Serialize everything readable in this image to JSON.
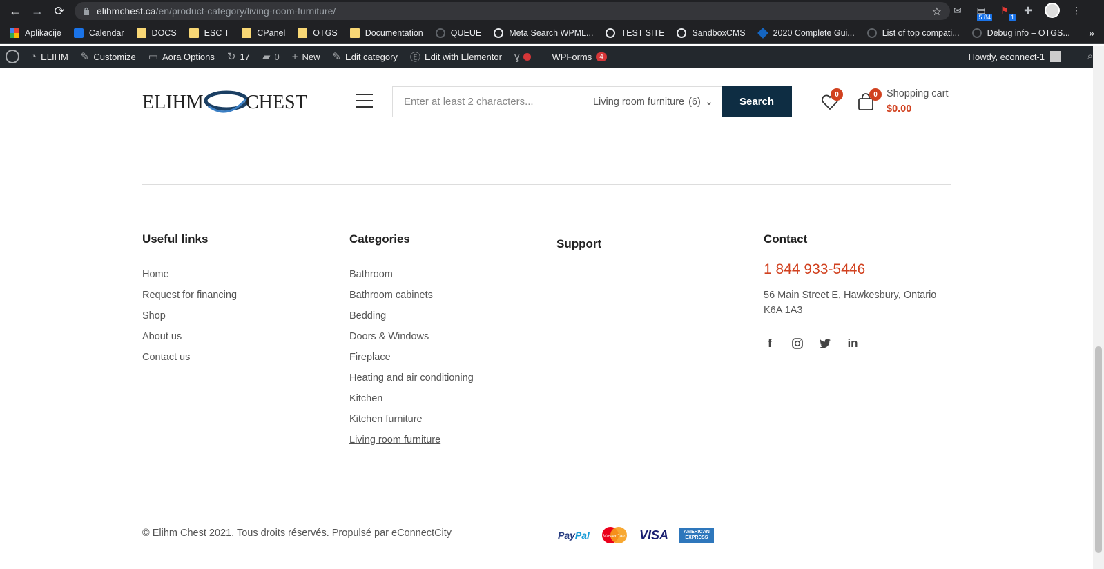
{
  "browser": {
    "url_host": "elihmchest.ca",
    "url_path": "/en/product-category/living-room-furniture/",
    "ext_badge_1": "5.84",
    "ext_badge_2": "1"
  },
  "bookmarks": [
    {
      "label": "Aplikacije",
      "icon": "apps-icon"
    },
    {
      "label": "Calendar",
      "icon": "calendar-icon"
    },
    {
      "label": "DOCS",
      "icon": "folder-icon"
    },
    {
      "label": "ESC T",
      "icon": "folder-icon"
    },
    {
      "label": "CPanel",
      "icon": "folder-icon"
    },
    {
      "label": "OTGS",
      "icon": "folder-icon"
    },
    {
      "label": "Documentation",
      "icon": "folder-icon"
    },
    {
      "label": "QUEUE",
      "icon": "page-icon"
    },
    {
      "label": "Meta Search WPML...",
      "icon": "search-icon"
    },
    {
      "label": "TEST SITE",
      "icon": "wordpress-icon"
    },
    {
      "label": "SandboxCMS",
      "icon": "wordpress-icon"
    },
    {
      "label": "2020 Complete Gui...",
      "icon": "cube-icon"
    },
    {
      "label": "List of top compati...",
      "icon": "page-icon"
    },
    {
      "label": "Debug info – OTGS...",
      "icon": "page-icon"
    }
  ],
  "wpbar": {
    "site": "ELIHM",
    "customize": "Customize",
    "aora": "Aora Options",
    "updates": "17",
    "comments": "0",
    "new": "New",
    "edit_category": "Edit category",
    "elementor": "Edit with Elementor",
    "wpforms": "WPForms",
    "wpforms_count": "4",
    "howdy": "Howdy, econnect-1"
  },
  "header": {
    "logo_text_left": "ELIHM",
    "logo_text_right": "CHEST",
    "search_placeholder": "Enter at least 2 characters...",
    "category_select": "Living room furniture",
    "category_count": "(6)",
    "search_button": "Search",
    "wishlist_count": "0",
    "cart_count": "0",
    "cart_label": "Shopping cart",
    "cart_total": "$0.00"
  },
  "footer": {
    "useful_links": {
      "title": "Useful links",
      "items": [
        "Home",
        "Request for financing",
        "Shop",
        "About us",
        "Contact us"
      ]
    },
    "categories": {
      "title": "Categories",
      "items": [
        "Bathroom",
        "Bathroom cabinets",
        "Bedding",
        "Doors & Windows",
        "Fireplace",
        "Heating and air conditioning",
        "Kitchen",
        "Kitchen furniture",
        "Living room furniture"
      ],
      "active": "Living room furniture"
    },
    "support": {
      "title": "Support"
    },
    "contact": {
      "title": "Contact",
      "phone": "1 844 933-5446",
      "address": "56 Main Street E, Hawkesbury, Ontario K6A 1A3",
      "socials": [
        "facebook-icon",
        "instagram-icon",
        "twitter-icon",
        "linkedin-icon"
      ]
    },
    "copyright": "© Elihm Chest 2021. Tous droits réservés. Propulsé par eConnectCity",
    "payments": {
      "paypal_a": "Pay",
      "paypal_b": "Pal",
      "mastercard": "MasterCard",
      "visa": "VISA",
      "amex": "AMERICAN EXPRESS"
    }
  },
  "colors": {
    "accent": "#d1411f",
    "search_button_bg": "#0e2d43",
    "wpbar_bg": "#23282d",
    "chrome_bg": "#202124"
  }
}
